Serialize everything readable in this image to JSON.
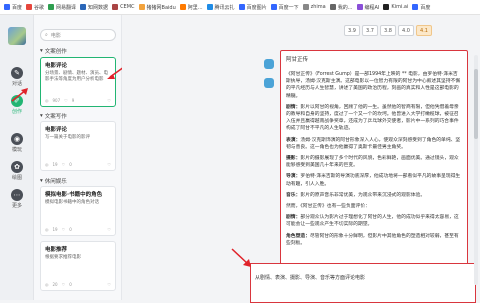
{
  "bookmarks": [
    {
      "label": "百度",
      "color": "#3366ff"
    },
    {
      "label": "谷歌",
      "color": "#e6463c"
    },
    {
      "label": "网易翻译",
      "color": "#2e9e4f"
    },
    {
      "label": "知网数据",
      "color": "#2a66b8"
    },
    {
      "label": "CEMC",
      "color": "#aa4444"
    },
    {
      "label": "猪猪网Baidu",
      "color": "#f2a23c"
    },
    {
      "label": "阿里...",
      "color": "#ff7a00"
    },
    {
      "label": "腾讯云扎",
      "color": "#1f8ce6"
    },
    {
      "label": "百度图片",
      "color": "#3366ff"
    },
    {
      "label": "百度一下",
      "color": "#3366ff"
    },
    {
      "label": "zhima",
      "color": "#888888"
    },
    {
      "label": "我的...",
      "color": "#666666"
    },
    {
      "label": "编程AI",
      "color": "#8a4fd8"
    },
    {
      "label": "Kimi.ai",
      "color": "#222222"
    },
    {
      "label": "百度",
      "color": "#3366ff"
    }
  ],
  "nav": [
    {
      "label": "对话",
      "icon": "chat-icon"
    },
    {
      "label": "创作",
      "icon": "edit-icon",
      "active": true
    },
    {
      "label": "模玩",
      "icon": "model-icon"
    },
    {
      "label": "绘图",
      "icon": "paint-icon"
    },
    {
      "label": "更多",
      "icon": "more-icon"
    }
  ],
  "search": {
    "value": "电影"
  },
  "sections": {
    "s1": "文案创作",
    "s2": "文案写作",
    "s3": "休闲娱乐"
  },
  "cards": [
    {
      "title": "电影评论",
      "desc": "分场景、剧情、题材、演员、电影手法等角度为用户分析电影",
      "views": "907",
      "likes": "9"
    },
    {
      "title": "电影评论",
      "desc": "写一篇关于电影的影评",
      "views": "19",
      "likes": "0"
    },
    {
      "title": "模拟电影·书籍中的角色",
      "desc": "模拟电影书籍中的角色对话",
      "views": "19",
      "likes": "0"
    },
    {
      "title": "电影推荐",
      "desc": "根据要求推荐电影",
      "views": "20",
      "likes": "0"
    }
  ],
  "tabs": [
    "3.9",
    "3.7",
    "3.8",
    "4.0",
    "4.1"
  ],
  "answer": {
    "question": "阿甘正传",
    "paras": [
      {
        "b": "",
        "t": "《阿甘正传》（Forrest Gump）是一部1994年上映的 ** 电影，由罗伯特·泽米吉斯执导，汤姆·汉克斯主演。这部电影以一位智力有限的阿甘为中心叙述其坚持不懈的平凡经历与人生智慧，讲述了美国的政治历程，刻画的真实和人性是这部电影的精髓。"
      },
      {
        "b": "剧情：",
        "t": "影片以阿甘的视角，回顾了他的一生。虽然他的智商有限，但他凭借着母亲的教导和自身的坚持，度过了一个又一个的坎坷。他曾进入大学打橄榄球，被征召入伍并且赢得越南战争奖章，还成为了乒乓球外交使者，影片中一系列的巧合事件构成了阿甘不平凡的人生轨迹。"
      },
      {
        "b": "表演：",
        "t": "汤姆·汉克斯饰演的阿甘形象深入人心，使观众深刻感受到了角色的单纯、坚韧与善良。这一角色也为他赢得了奥斯卡最佳男主角奖。"
      },
      {
        "b": "摄影：",
        "t": "影片的摄影展现了多个时代的风貌，色彩鲜艳，画面优美。通过镜头，观众能够感受到美国几十年来的巨变。"
      },
      {
        "b": "导演：",
        "t": "罗伯特·泽米吉斯的导演功底深厚，他成功地将一部看似平凡的故事呈现得生动有趣，引人入胜。"
      },
      {
        "b": "音乐：",
        "t": "影片的原声音乐非常优美，为观众带来沉浸式的观影体验。"
      },
      {
        "b": "",
        "t": "然而，《阿甘正传》也有一些负面评价："
      },
      {
        "b": "剧情：",
        "t": "部分观众认为影片过于理想化了阿甘的人生，他的成功似乎来得太容易，这可能会让一些观众产生不切实际的期望。"
      },
      {
        "b": "角色塑造：",
        "t": "尽管阿甘的形象十分鲜明，但影片中其他角色的塑造相对较弱，甚至有些刻板。"
      }
    ]
  },
  "input": {
    "value": "从剧情、表演、摄影、导演、音乐等方面评论电影"
  }
}
